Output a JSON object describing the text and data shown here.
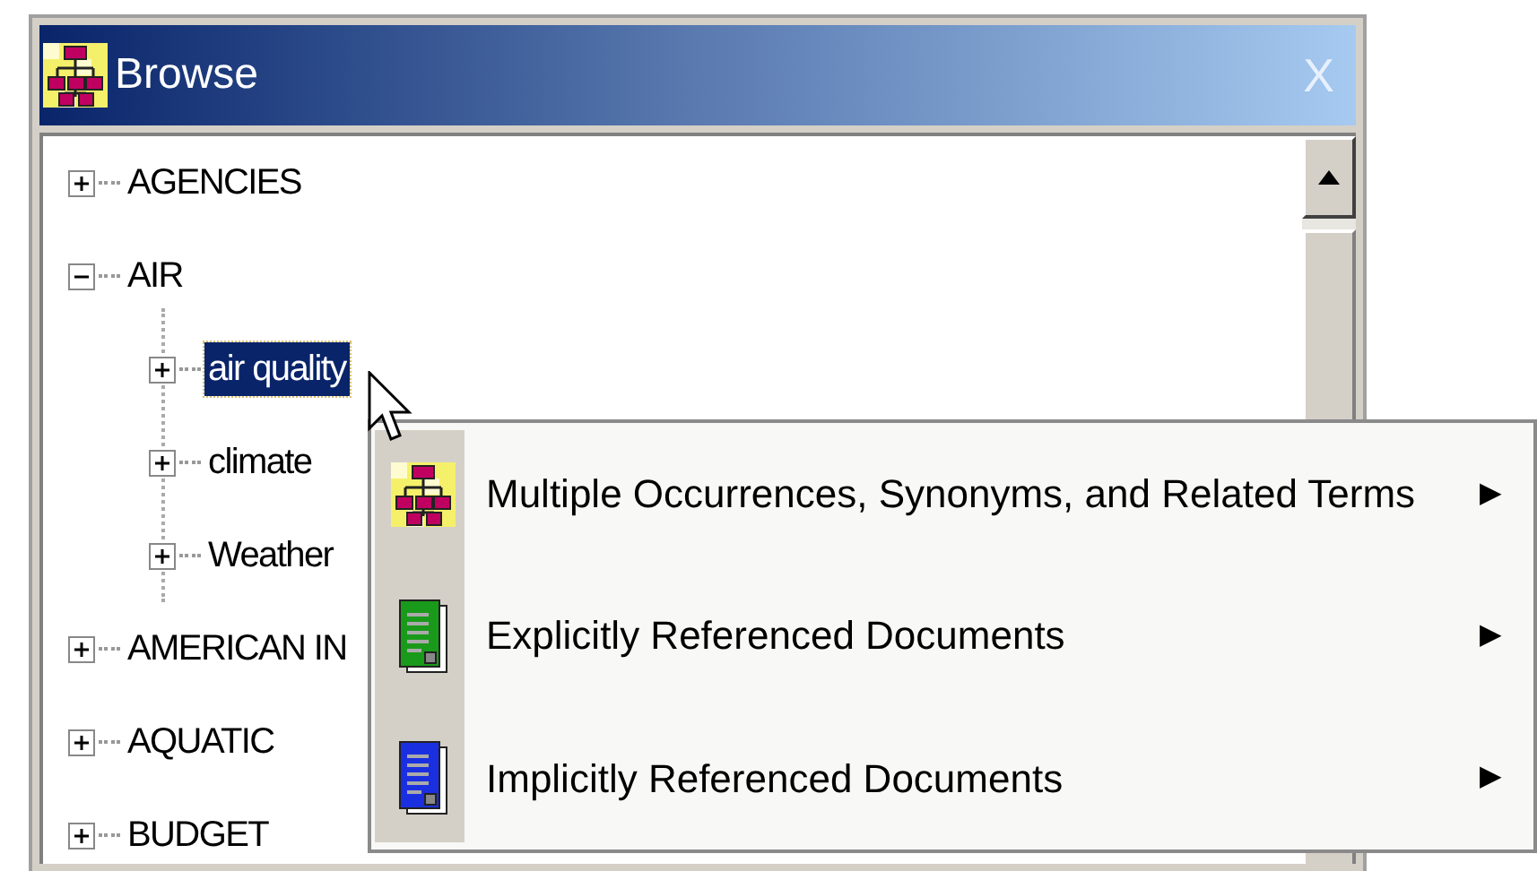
{
  "window": {
    "title": "Browse",
    "close": "X"
  },
  "tree": [
    {
      "label": "AGENCIES",
      "expanded": false,
      "selected": false
    },
    {
      "label": "AIR",
      "expanded": true,
      "selected": false,
      "children": [
        {
          "label": "air quality",
          "expanded": false,
          "selected": true
        },
        {
          "label": "climate",
          "expanded": false,
          "selected": false
        },
        {
          "label": "Weather",
          "expanded": false,
          "selected": false
        }
      ]
    },
    {
      "label": "AMERICAN IN",
      "expanded": false,
      "selected": false
    },
    {
      "label": "AQUATIC",
      "expanded": false,
      "selected": false
    },
    {
      "label": "BUDGET",
      "expanded": false,
      "selected": false
    }
  ],
  "context_menu": [
    {
      "kind": "terms",
      "label": "Multiple Occurrences, Synonyms, and Related Terms",
      "submenu": "▶"
    },
    {
      "kind": "explicit",
      "label": "Explicitly Referenced Documents",
      "submenu": "▶"
    },
    {
      "kind": "implicit",
      "label": "Implicitly Referenced Documents",
      "submenu": "▶"
    }
  ]
}
